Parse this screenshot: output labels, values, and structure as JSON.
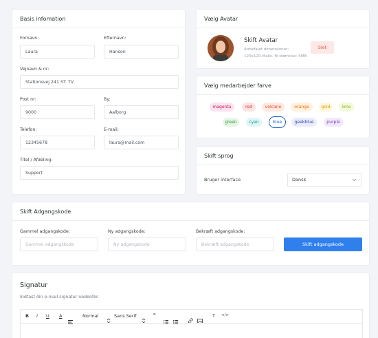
{
  "basis": {
    "title": "Basis infomation",
    "fornavn": {
      "label": "Fornavn:",
      "value": "Laura"
    },
    "efternavn": {
      "label": "Efternavn:",
      "value": "Hanson"
    },
    "vejnavn": {
      "label": "Vejnavn & nr:",
      "value": "Stationsvej 241 ST. TV"
    },
    "postnr": {
      "label": "Post nr:",
      "value": "9000"
    },
    "by": {
      "label": "By:",
      "value": "Aalborg"
    },
    "telefon": {
      "label": "Telefon:",
      "value": "12345678"
    },
    "email": {
      "label": "E-mail:",
      "value": "laura@mail.com"
    },
    "titel": {
      "label": "Titel / Afdeling:",
      "value": "Support"
    }
  },
  "avatar": {
    "title": "Vælg Avatar",
    "heading": "Skift Avatar",
    "hint1": "Anbefalet dimensioner:",
    "hint2": "120x120.Maks. fil størrelse: 5MB",
    "delete_label": "Slet"
  },
  "color": {
    "title": "Vælg medarbejder farve",
    "selected": "blue",
    "chips": [
      {
        "label": "magenta",
        "bg": "#fde3ef",
        "fg": "#c2185b"
      },
      {
        "label": "red",
        "bg": "#fde4e4",
        "fg": "#d32f2f"
      },
      {
        "label": "volcano",
        "bg": "#fee9e1",
        "fg": "#e64a19"
      },
      {
        "label": "orange",
        "bg": "#fff0df",
        "fg": "#ef6c00"
      },
      {
        "label": "gold",
        "bg": "#fff7d9",
        "fg": "#d4a106"
      },
      {
        "label": "lime",
        "bg": "#f3fadb",
        "fg": "#8bb01c"
      },
      {
        "label": "green",
        "bg": "#e6f6e6",
        "fg": "#388e3c"
      },
      {
        "label": "cyan",
        "bg": "#e0f6f6",
        "fg": "#0f9a9a"
      },
      {
        "label": "blue",
        "bg": "#e6f0fd",
        "fg": "#1e63c6"
      },
      {
        "label": "geekblue",
        "bg": "#e8ecfb",
        "fg": "#3949ab"
      },
      {
        "label": "purple",
        "bg": "#f1e8fb",
        "fg": "#7b3fb8"
      }
    ]
  },
  "language": {
    "title": "Skift sprog",
    "label": "Bruger interface",
    "selected": "Dansk"
  },
  "password": {
    "title": "Skift Adgangskode",
    "old_label": "Gammel adgangskode:",
    "old_placeholder": "Gammel adgangskode",
    "new_label": "Ny adgangskode:",
    "new_placeholder": "Ny adgangskode",
    "confirm_label": "Bekræft adgangskode:",
    "confirm_placeholder": "Bekræft adgangskode",
    "submit_label": "Skift adgangskode",
    "accent": "#2f80ed"
  },
  "signature": {
    "title": "Signatur",
    "hint": "Indtast din e-mail signatur nedenfor.",
    "toolbar": {
      "bold": "B",
      "italic": "I",
      "underline": "U",
      "color": "A",
      "heading": "Normal",
      "font": "Sans Serif",
      "quote": "❞",
      "clear": "T",
      "code": "</>"
    }
  }
}
